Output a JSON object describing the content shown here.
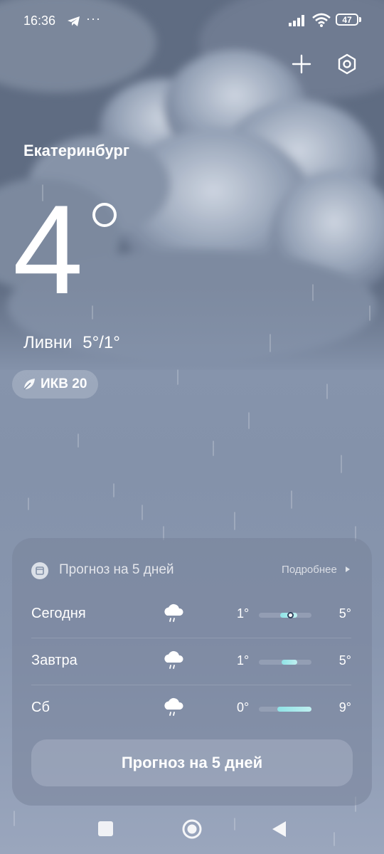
{
  "status_bar": {
    "time": "16:36",
    "more_indicator": "···",
    "battery": "47"
  },
  "icons": {
    "telegram": "telegram-icon",
    "signal": "signal-icon",
    "wifi": "wifi-icon",
    "add": "plus-icon",
    "settings": "hexagon-settings-icon",
    "aqi": "leaf-icon",
    "calendar": "calendar-icon",
    "more_arrow": "triangle-right-icon"
  },
  "weather": {
    "city": "Екатеринбург",
    "temperature": "4",
    "condition": "Ливни",
    "high_low": "5°/1°",
    "aqi": "ИКВ 20"
  },
  "forecast": {
    "title": "Прогноз на 5 дней",
    "more_label": "Подробнее",
    "button_label": "Прогноз на 5 дней",
    "days": [
      {
        "day": "Сегодня",
        "icon": "rain-cloud-icon",
        "low": "1°",
        "high": "5°"
      },
      {
        "day": "Завтра",
        "icon": "rain-cloud-icon",
        "low": "1°",
        "high": "5°"
      },
      {
        "day": "Сб",
        "icon": "rain-cloud-icon",
        "low": "0°",
        "high": "9°"
      }
    ]
  },
  "colors": {
    "background": "#8492aa",
    "card": "#78849b",
    "range_fill": "#8fe3e6"
  }
}
